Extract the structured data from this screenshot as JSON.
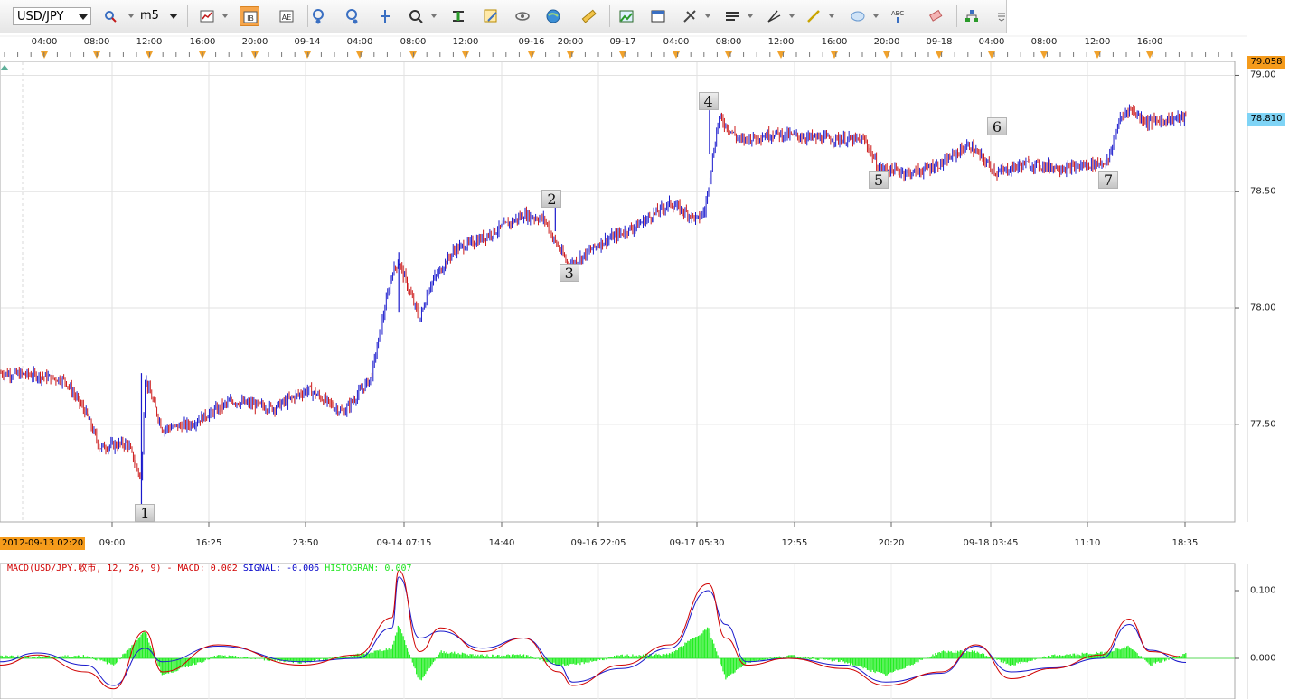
{
  "toolbar": {
    "symbol": "USD/JPY",
    "period": "m5",
    "buttons": [
      "line-chart-icon",
      "bar-chart-icon",
      "candlestick-icon",
      "zoom-in-icon",
      "zoom-out-icon",
      "crosshair-icon",
      "magnifier-icon",
      "fit-icon",
      "edit-icon",
      "eye-icon",
      "globe-icon",
      "ruler-icon",
      "image-icon",
      "window-icon",
      "tools-icon",
      "lines-icon",
      "pen-icon",
      "line-icon",
      "ellipse-icon",
      "text-abc-icon",
      "eraser-icon",
      "tree-icon",
      "more-icon"
    ]
  },
  "price_chart": {
    "top_time_labels": [
      "04:00",
      "08:00",
      "12:00",
      "16:00",
      "20:00",
      "09-14",
      "04:00",
      "08:00",
      "12:00",
      "09-16",
      "20:00",
      "09-17",
      "04:00",
      "08:00",
      "12:00",
      "16:00",
      "20:00",
      "09-18",
      "04:00",
      "08:00",
      "12:00",
      "16:00"
    ],
    "bottom_time_labels": [
      "09:00",
      "16:25",
      "23:50",
      "09-14 07:15",
      "14:40",
      "09-16 22:05",
      "09-17 05:30",
      "12:55",
      "20:20",
      "09-18 03:45",
      "11:10",
      "18:35"
    ],
    "start_date": "2012-09-13 02:20",
    "y_ticks": [
      "79.00",
      "78.50",
      "78.00",
      "77.50"
    ],
    "high_tag": "79.058",
    "last_price_tag": "78.810",
    "markers": [
      "1",
      "2",
      "3",
      "4",
      "5",
      "6",
      "7"
    ],
    "colors": {
      "up": "#1a1acc",
      "down": "#cc1a1a",
      "grid": "#e4e4e4",
      "high_tag": "#f59b1b",
      "last_tag": "#7fd4f6"
    }
  },
  "macd_panel": {
    "legend_name": "MACD(USD/JPY.收市, 12, 26, 9) -",
    "legend_macd": "MACD: 0.002",
    "legend_signal": "SIGNAL: -0.006",
    "legend_hist": "HISTOGRAM: 0.007",
    "y_ticks": [
      "0.100",
      "0.000"
    ]
  },
  "chart_data": {
    "type": "candlestick",
    "symbol": "USD/JPY",
    "timeframe": "m5",
    "ylim": [
      77.08,
      79.06
    ],
    "y_ticks": [
      77.5,
      78.0,
      78.5,
      79.0
    ],
    "last_price": 78.81,
    "high_marker": 79.058,
    "price_path": {
      "x": [
        "09-13 02:20",
        "09-13 05:00",
        "09-13 07:00",
        "09-13 08:30",
        "09-13 09:30",
        "09-13 11:30",
        "09-13 12:30",
        "09-13 12:45",
        "09-13 14:00",
        "09-13 16:00",
        "09-13 19:00",
        "09-13 22:00",
        "09-14 00:30",
        "09-14 03:00",
        "09-14 05:00",
        "09-14 06:30",
        "09-14 07:00",
        "09-14 08:30",
        "09-14 09:15",
        "09-14 11:00",
        "09-14 13:00",
        "09-14 16:00",
        "09-14 17:30",
        "09-16 21:00",
        "09-16 22:15",
        "09-17 00:30",
        "09-17 03:00",
        "09-17 05:30",
        "09-17 07:30",
        "09-17 08:00",
        "09-17 09:00",
        "09-17 10:30",
        "09-17 13:00",
        "09-17 16:00",
        "09-17 19:30",
        "09-17 20:30",
        "09-17 23:00",
        "09-18 01:00",
        "09-18 03:00",
        "09-18 05:00",
        "09-18 07:00",
        "09-18 10:00",
        "09-18 13:00",
        "09-18 13:45",
        "09-18 14:30",
        "09-18 15:45",
        "09-18 18:35"
      ],
      "y": [
        77.72,
        77.71,
        77.69,
        77.55,
        77.4,
        77.42,
        77.26,
        77.7,
        77.48,
        77.5,
        77.6,
        77.57,
        77.65,
        77.55,
        77.7,
        78.15,
        78.2,
        77.95,
        78.1,
        78.25,
        78.3,
        78.4,
        78.38,
        78.31,
        78.18,
        78.28,
        78.35,
        78.45,
        78.38,
        78.42,
        78.82,
        78.72,
        78.75,
        78.73,
        78.72,
        78.6,
        78.58,
        78.62,
        78.7,
        78.58,
        78.62,
        78.6,
        78.63,
        78.8,
        78.86,
        78.8,
        78.82
      ]
    },
    "point_labels": [
      {
        "label": "1",
        "x": "09-13 12:45",
        "y": 77.12
      },
      {
        "label": "2",
        "x": "09-16 21:00",
        "y": 78.47
      },
      {
        "label": "3",
        "x": "09-16 22:15",
        "y": 78.15
      },
      {
        "label": "4",
        "x": "09-17 08:15",
        "y": 78.89
      },
      {
        "label": "5",
        "x": "09-17 20:30",
        "y": 78.55
      },
      {
        "label": "6",
        "x": "09-18 05:00",
        "y": 78.78
      },
      {
        "label": "7",
        "x": "09-18 13:00",
        "y": 78.55
      }
    ],
    "macd": {
      "params": [
        12,
        26,
        9
      ],
      "current": {
        "macd": 0.002,
        "signal": -0.006,
        "histogram": 0.007
      },
      "ylim": [
        -0.06,
        0.14
      ],
      "y_ticks": [
        0.0,
        0.1
      ],
      "x": [
        "09-13 02:20",
        "09-13 05:00",
        "09-13 08:30",
        "09-13 10:30",
        "09-13 12:45",
        "09-13 14:00",
        "09-13 18:00",
        "09-14 00:00",
        "09-14 04:00",
        "09-14 06:30",
        "09-14 07:00",
        "09-14 08:30",
        "09-14 10:00",
        "09-14 13:00",
        "09-14 16:00",
        "09-16 21:30",
        "09-16 22:30",
        "09-17 02:00",
        "09-17 05:30",
        "09-17 08:15",
        "09-17 09:30",
        "09-17 11:00",
        "09-17 14:00",
        "09-17 18:00",
        "09-17 21:00",
        "09-18 01:00",
        "09-18 03:30",
        "09-18 06:00",
        "09-18 09:00",
        "09-18 12:30",
        "09-18 14:30",
        "09-18 16:00",
        "09-18 18:35"
      ],
      "macd_values": [
        -0.01,
        0.005,
        -0.02,
        -0.045,
        0.04,
        -0.02,
        0.02,
        -0.01,
        0.005,
        0.06,
        0.13,
        0.01,
        0.045,
        0.01,
        0.03,
        -0.02,
        -0.04,
        -0.01,
        0.02,
        0.11,
        0.03,
        -0.01,
        0.0,
        -0.015,
        -0.04,
        -0.02,
        0.02,
        -0.03,
        -0.015,
        0.005,
        0.058,
        0.01,
        0.002
      ],
      "signal_values": [
        -0.005,
        0.008,
        -0.01,
        -0.04,
        0.015,
        -0.005,
        0.018,
        -0.005,
        0.0,
        0.045,
        0.12,
        0.03,
        0.04,
        0.015,
        0.03,
        -0.01,
        -0.035,
        -0.015,
        0.015,
        0.1,
        0.05,
        -0.005,
        0.0,
        -0.01,
        -0.035,
        -0.022,
        0.018,
        -0.02,
        -0.014,
        0.0,
        0.05,
        0.012,
        -0.006
      ],
      "histogram_values": [
        0.004,
        0.002,
        0.004,
        -0.01,
        0.04,
        -0.025,
        0.004,
        -0.006,
        0.005,
        0.015,
        0.05,
        -0.035,
        0.01,
        0.004,
        0.005,
        -0.01,
        -0.01,
        0.004,
        0.006,
        0.045,
        -0.03,
        -0.006,
        0.004,
        -0.005,
        -0.025,
        0.01,
        0.01,
        -0.01,
        0.004,
        0.008,
        0.018,
        -0.01,
        0.007
      ]
    }
  }
}
